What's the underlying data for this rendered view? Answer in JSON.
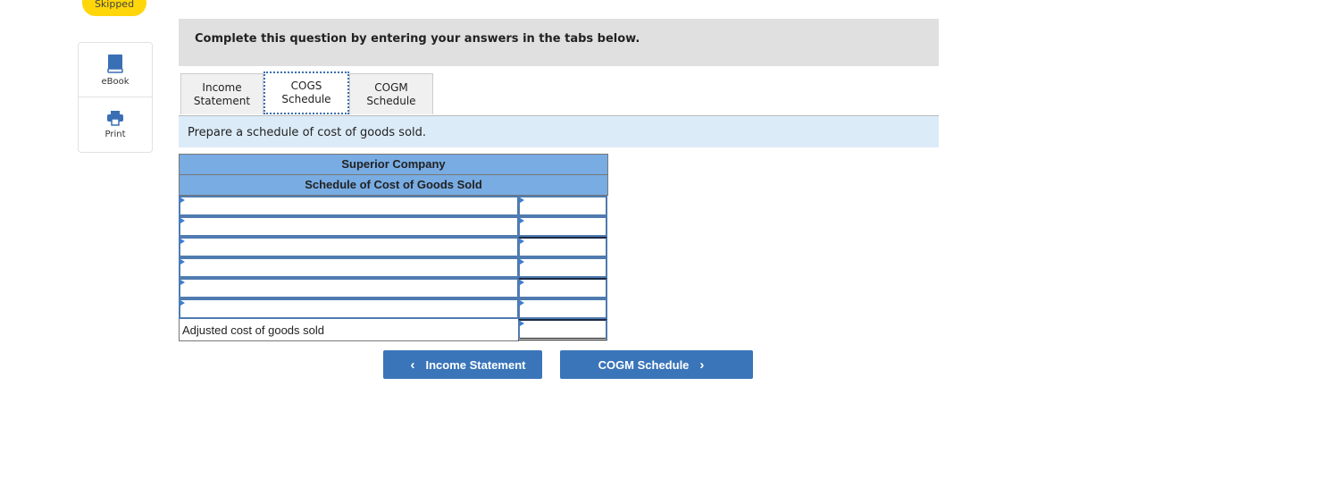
{
  "status_badge": "Skipped",
  "side_tools": [
    {
      "label": "eBook",
      "icon": "book-icon"
    },
    {
      "label": "Print",
      "icon": "printer-icon"
    }
  ],
  "instruction": "Complete this question by entering your answers in the tabs below.",
  "tabs": [
    {
      "line1": "Income",
      "line2": "Statement",
      "active": false
    },
    {
      "line1": "COGS",
      "line2": "Schedule",
      "active": true
    },
    {
      "line1": "COGM",
      "line2": "Schedule",
      "active": false
    }
  ],
  "prompt": "Prepare a schedule of cost of goods sold.",
  "schedule": {
    "company": "Superior Company",
    "title": "Schedule of Cost of Goods Sold",
    "rows": [
      {
        "label": "",
        "amount": ""
      },
      {
        "label": "",
        "amount": ""
      },
      {
        "label": "",
        "amount": ""
      },
      {
        "label": "",
        "amount": ""
      },
      {
        "label": "",
        "amount": ""
      },
      {
        "label": "",
        "amount": ""
      }
    ],
    "total_label": "Adjusted cost of goods sold",
    "total_amount": ""
  },
  "nav": {
    "prev_label": "Income Statement",
    "next_label": "COGM Schedule"
  }
}
